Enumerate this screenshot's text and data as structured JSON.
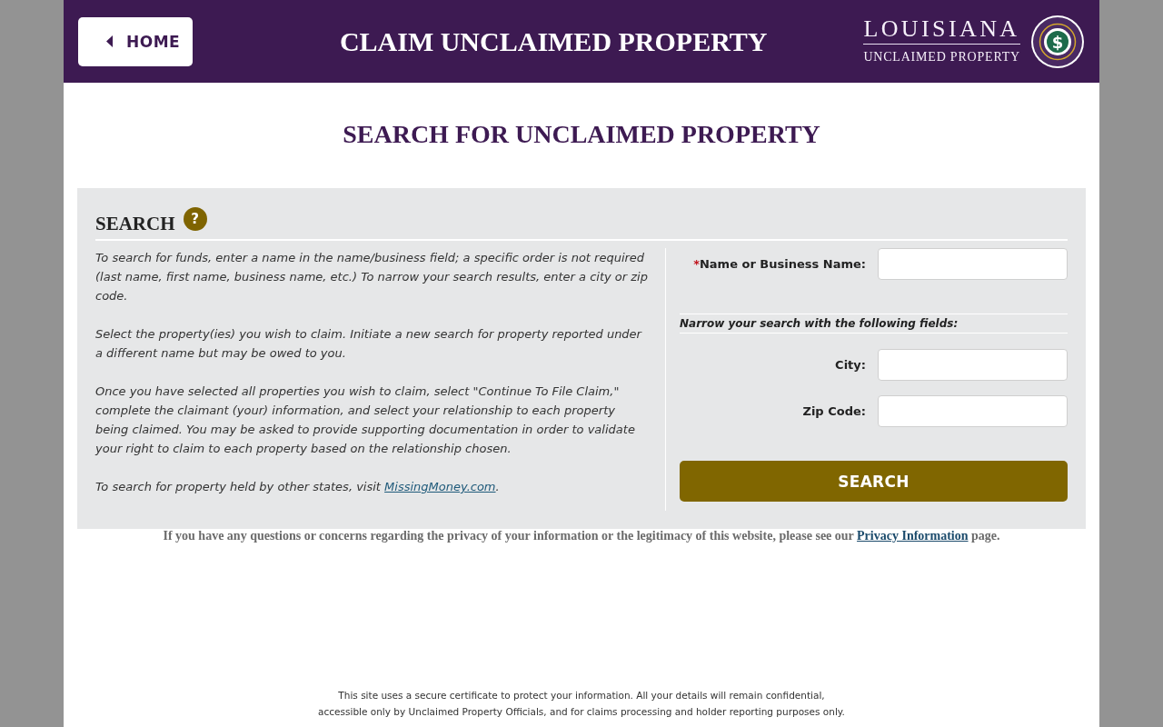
{
  "header": {
    "home_button": "HOME",
    "title": "CLAIM UNCLAIMED PROPERTY",
    "logo": {
      "line_1": "LOUISIANA",
      "line_2": "UNCLAIMED PROPERTY",
      "seal_symbol": "$"
    }
  },
  "page_title": "SEARCH FOR UNCLAIMED PROPERTY",
  "search_panel": {
    "heading": "SEARCH",
    "help_icon": "?",
    "instructions": [
      {
        "text": "To search for funds, enter a name in the name/business field; a specific order is not required (last name, first name, business name, etc.) To narrow your search results, enter a city or zip code."
      },
      {
        "text": "Select the property(ies) you wish to claim. Initiate a new search for property reported under a different name but may be owed to you."
      },
      {
        "text": "Once you have selected all properties you wish to claim, select \"Continue To File Claim,\" complete the claimant (your) information, and select your relationship to each property being claimed. You may be asked to provide supporting documentation in order to validate your right to claim to each property based on the relationship chosen."
      },
      {
        "text": "To search for property held by other states, visit ",
        "link": "MissingMoney.com",
        "after": "."
      }
    ],
    "form": {
      "main_field": {
        "mark": "*",
        "label": "Name or Business Name:"
      },
      "narrow_heading": "Narrow your search with the following fields:",
      "fields": [
        {
          "label": "City:"
        },
        {
          "label": "Zip Code:"
        }
      ],
      "button": "SEARCH"
    }
  },
  "privacy_note": {
    "text": "If you have any questions or concerns regarding the privacy of your information or the legitimacy of this website, please see our ",
    "link": "Privacy Information",
    "after": " page."
  },
  "footer": {
    "security_notice": [
      "This site uses a secure certificate to protect your information. All your details will remain confidential,",
      "accessible only by Unclaimed Property Officials, and for claims processing and holder reporting purposes only."
    ]
  }
}
